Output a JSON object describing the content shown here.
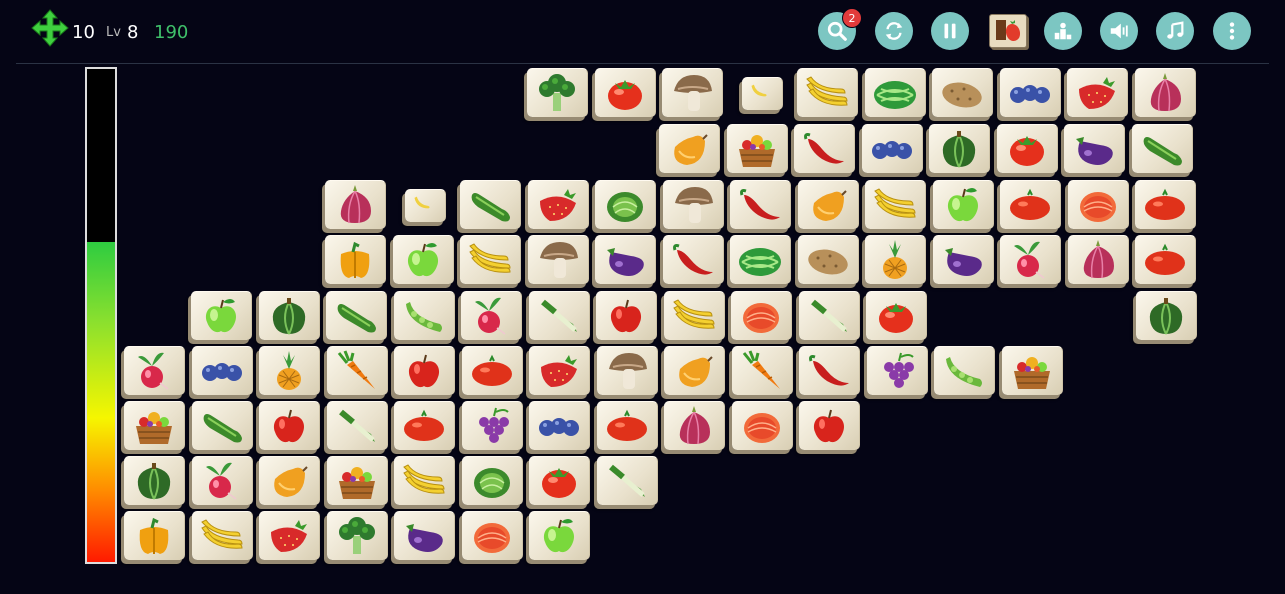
{
  "hud": {
    "moves": "10",
    "level_label": "Lv",
    "level": "8",
    "score": "190",
    "hint_count": "2"
  },
  "buttons": [
    {
      "name": "hint-button",
      "icon": "search-icon"
    },
    {
      "name": "shuffle-button",
      "icon": "shuffle-icon"
    },
    {
      "name": "pause-button",
      "icon": "pause-icon"
    },
    {
      "name": "theme-button",
      "icon": "tile-theme-icon"
    },
    {
      "name": "leaderboard-button",
      "icon": "podium-icon"
    },
    {
      "name": "sound-button",
      "icon": "speaker-icon"
    },
    {
      "name": "music-button",
      "icon": "music-note-icon"
    },
    {
      "name": "menu-button",
      "icon": "more-vertical-icon"
    }
  ],
  "timer": {
    "remaining_fraction": 0.65
  },
  "colors": {
    "background": "#050515",
    "button": "#7cc6c2",
    "score": "#3fc06a",
    "badge": "#e23b3b"
  },
  "tile_rows": [
    [
      "broccoli",
      "tomato",
      "mushroom",
      "banana-small",
      "bananas",
      "watermelon",
      "potato",
      "blueberries",
      "strawberry",
      "onion"
    ],
    [
      "",
      "",
      "",
      "",
      "",
      "",
      "",
      "",
      "papaya",
      "fruit-basket",
      "chili-pepper",
      "blueberries",
      "squash",
      "tomato",
      "eggplant",
      "cucumber"
    ],
    [
      "onion",
      "banana-small",
      "cucumber",
      "strawberry",
      "cabbage",
      "mushroom",
      "chili-pepper",
      "papaya",
      "bananas",
      "green-apple",
      "red-tomato",
      "peach",
      "red-tomato"
    ],
    [
      "bell-pepper",
      "green-apple",
      "bananas",
      "mushroom",
      "eggplant",
      "chili-pepper",
      "watermelon",
      "potato",
      "pineapple",
      "eggplant",
      "radish",
      "onion",
      "red-tomato"
    ],
    [
      "green-apple",
      "squash",
      "cucumber",
      "pea-pod",
      "radish",
      "leek",
      "red-apple",
      "bananas",
      "peach",
      "leek",
      "tomato",
      "",
      "",
      "",
      "squash"
    ],
    [
      "radish",
      "blueberries",
      "pineapple",
      "carrot",
      "red-apple",
      "red-tomato",
      "strawberry",
      "mushroom",
      "papaya",
      "carrot",
      "chili-pepper",
      "grapes",
      "pea-pod",
      "fruit-basket"
    ],
    [
      "fruit-basket",
      "cucumber",
      "red-apple",
      "leek",
      "red-tomato",
      "grapes",
      "blueberries",
      "red-tomato",
      "onion",
      "peach",
      "red-apple"
    ],
    [
      "squash",
      "radish",
      "papaya",
      "fruit-basket",
      "bananas",
      "cabbage",
      "tomato",
      "leek"
    ],
    [
      "bell-pepper",
      "bananas",
      "strawberry",
      "broccoli",
      "eggplant",
      "peach",
      "green-apple"
    ]
  ]
}
